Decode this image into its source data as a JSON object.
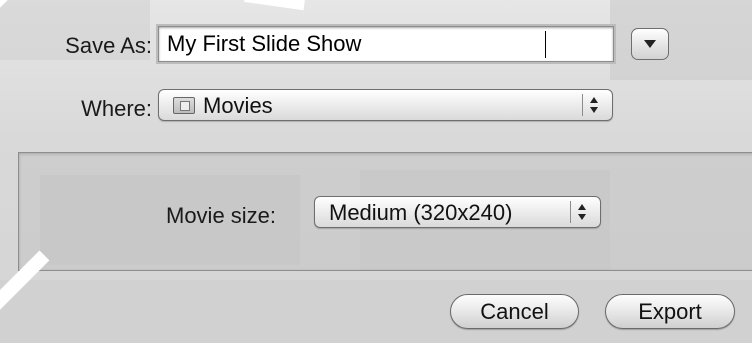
{
  "dialog": {
    "save_as_label": "Save As:",
    "file_name": "My First Slide Show",
    "where_label": "Where:",
    "where_value": "Movies",
    "movie_size_label": "Movie size:",
    "movie_size_value": "Medium (320x240)",
    "cancel_label": "Cancel",
    "export_label": "Export"
  },
  "icons": {
    "disclosure": "chevron-down-icon",
    "folder": "folder-icon",
    "stepper": "stepper-arrows-icon"
  }
}
